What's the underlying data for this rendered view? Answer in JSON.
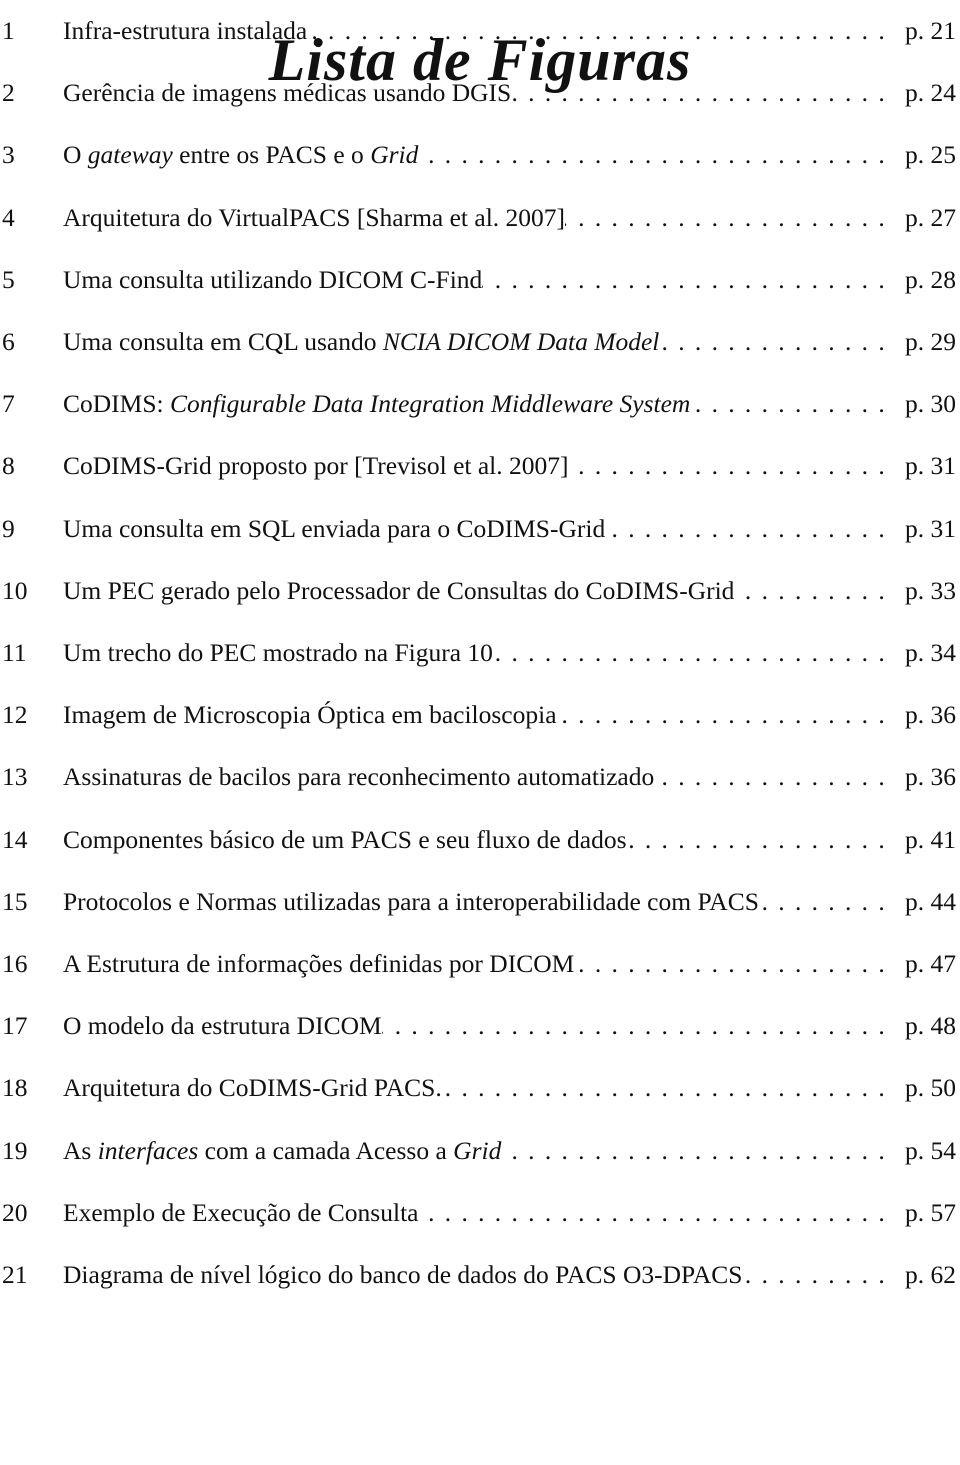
{
  "title": "Lista de Figuras",
  "entries": [
    {
      "num": "1",
      "label": [
        {
          "t": "Infra-estrutura instalada",
          "i": false
        }
      ],
      "page": "p. 21"
    },
    {
      "num": "2",
      "label": [
        {
          "t": "Gerência de imagens médicas usando DGIS",
          "i": false
        }
      ],
      "page": "p. 24"
    },
    {
      "num": "3",
      "label": [
        {
          "t": "O ",
          "i": false
        },
        {
          "t": "gateway",
          "i": true
        },
        {
          "t": " entre os PACS e o ",
          "i": false
        },
        {
          "t": "Grid",
          "i": true
        }
      ],
      "page": "p. 25"
    },
    {
      "num": "4",
      "label": [
        {
          "t": "Arquitetura do VirtualPACS [Sharma et al. 2007]",
          "i": false
        }
      ],
      "page": "p. 27"
    },
    {
      "num": "5",
      "label": [
        {
          "t": "Uma consulta utilizando DICOM C-Find",
          "i": false
        }
      ],
      "page": "p. 28"
    },
    {
      "num": "6",
      "label": [
        {
          "t": "Uma consulta em CQL usando ",
          "i": false
        },
        {
          "t": "NCIA DICOM Data Model",
          "i": true
        }
      ],
      "page": "p. 29"
    },
    {
      "num": "7",
      "label": [
        {
          "t": "CoDIMS: ",
          "i": false
        },
        {
          "t": "Configurable Data Integration Middleware System",
          "i": true
        }
      ],
      "page": "p. 30"
    },
    {
      "num": "8",
      "label": [
        {
          "t": "CoDIMS-Grid proposto por [Trevisol et al. 2007]",
          "i": false
        }
      ],
      "page": "p. 31"
    },
    {
      "num": "9",
      "label": [
        {
          "t": "Uma consulta em SQL enviada para o CoDIMS-Grid",
          "i": false
        }
      ],
      "page": "p. 31"
    },
    {
      "num": "10",
      "label": [
        {
          "t": "Um PEC gerado pelo Processador de Consultas do CoDIMS-Grid",
          "i": false
        }
      ],
      "page": "p. 33"
    },
    {
      "num": "11",
      "label": [
        {
          "t": "Um trecho do PEC mostrado na Figura 10",
          "i": false
        }
      ],
      "page": "p. 34"
    },
    {
      "num": "12",
      "label": [
        {
          "t": "Imagem de Microscopia Óptica em baciloscopia",
          "i": false
        }
      ],
      "page": "p. 36"
    },
    {
      "num": "13",
      "label": [
        {
          "t": "Assinaturas de bacilos para reconhecimento automatizado",
          "i": false
        }
      ],
      "page": "p. 36"
    },
    {
      "num": "14",
      "label": [
        {
          "t": "Componentes básico de um PACS e seu fluxo de dados",
          "i": false
        }
      ],
      "page": "p. 41"
    },
    {
      "num": "15",
      "label": [
        {
          "t": "Protocolos e Normas utilizadas para a interoperabilidade com PACS",
          "i": false
        }
      ],
      "page": "p. 44"
    },
    {
      "num": "16",
      "label": [
        {
          "t": "A Estrutura de informações definidas por DICOM",
          "i": false
        }
      ],
      "page": "p. 47"
    },
    {
      "num": "17",
      "label": [
        {
          "t": "O modelo da estrutura DICOM",
          "i": false
        }
      ],
      "page": "p. 48"
    },
    {
      "num": "18",
      "label": [
        {
          "t": "Arquitetura do CoDIMS-Grid PACS.",
          "i": false
        }
      ],
      "page": "p. 50"
    },
    {
      "num": "19",
      "label": [
        {
          "t": "As ",
          "i": false
        },
        {
          "t": "interfaces",
          "i": true
        },
        {
          "t": " com a camada Acesso a ",
          "i": false
        },
        {
          "t": "Grid",
          "i": true
        }
      ],
      "page": "p. 54"
    },
    {
      "num": "20",
      "label": [
        {
          "t": "Exemplo de Execução de Consulta",
          "i": false
        }
      ],
      "page": "p. 57"
    },
    {
      "num": "21",
      "label": [
        {
          "t": "Diagrama de nível lógico do banco de dados do PACS O3-DPACS",
          "i": false
        }
      ],
      "page": "p. 62"
    }
  ]
}
